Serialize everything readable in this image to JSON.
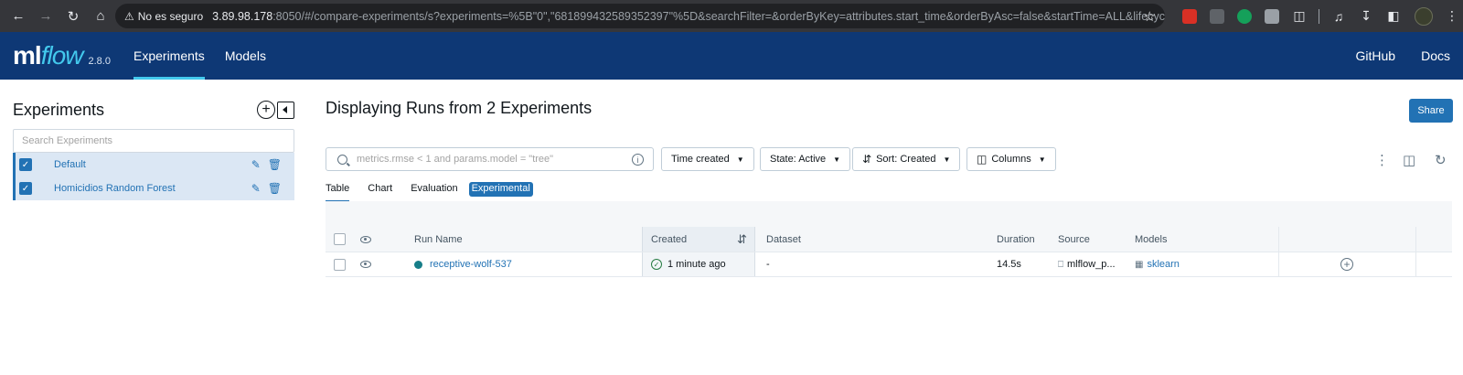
{
  "browser": {
    "security_label": "No es seguro",
    "url_host": "3.89.98.178",
    "url_rest": ":8050/#/compare-experiments/s?experiments=%5B\"0\",\"681899432589352397\"%5D&searchFilter=&orderByKey=attributes.start_time&orderByAsc=false&startTime=ALL&lifecycleFilter...",
    "nav_icons": [
      "back-icon",
      "forward-icon",
      "reload-icon",
      "home-icon"
    ]
  },
  "header": {
    "logo_ml": "ml",
    "logo_flow": "flow",
    "version": "2.8.0",
    "nav": [
      "Experiments",
      "Models"
    ],
    "nav_right": [
      "GitHub",
      "Docs"
    ],
    "bg_color": "#0e3875",
    "accent_color": "#43c9ed"
  },
  "sidebar": {
    "title": "Experiments",
    "search_placeholder": "Search Experiments",
    "experiments": [
      {
        "name": "Default",
        "checked": true
      },
      {
        "name": "Homicidios Random Forest",
        "checked": true
      }
    ]
  },
  "main": {
    "title": "Displaying Runs from 2 Experiments",
    "share_label": "Share",
    "search_placeholder": "metrics.rmse < 1 and params.model = \"tree\"",
    "filters": {
      "time_created": "Time created",
      "state": "State: Active",
      "sort": "Sort: Created",
      "columns": "Columns"
    },
    "tabs": [
      "Table",
      "Chart",
      "Evaluation",
      "Experimental"
    ],
    "active_tab": "Table",
    "primary_color": "#2272b4"
  },
  "table": {
    "headers": {
      "run_name": "Run Name",
      "created": "Created",
      "dataset": "Dataset",
      "duration": "Duration",
      "source": "Source",
      "models": "Models"
    },
    "rows": [
      {
        "run_name": "receptive-wolf-537",
        "created": "1 minute ago",
        "dataset": "-",
        "duration": "14.5s",
        "source": "mlflow_p...",
        "model": "sklearn"
      }
    ]
  }
}
